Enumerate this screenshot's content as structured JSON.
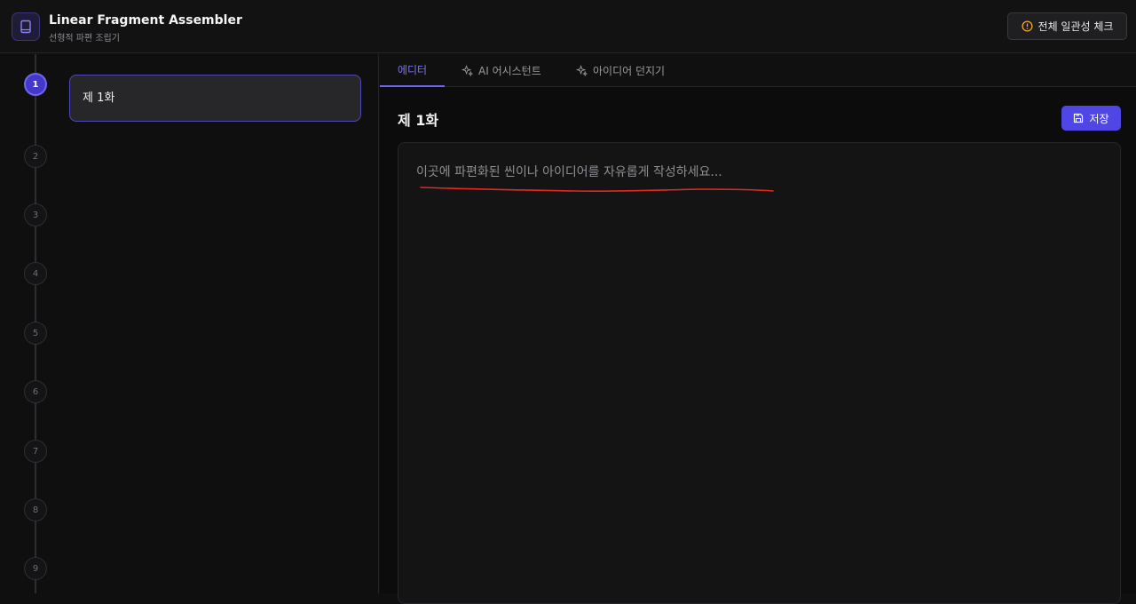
{
  "header": {
    "title": "Linear Fragment Assembler",
    "subtitle": "선형적 파편 조립기",
    "logo_icon": "book-icon",
    "check_button": {
      "label": "전체 일관성 체크",
      "icon": "alert-circle-icon",
      "icon_color": "#f5a623"
    }
  },
  "timeline": {
    "steps": [
      "1",
      "2",
      "3",
      "4",
      "5",
      "6",
      "7",
      "8",
      "9"
    ],
    "active_step": "1"
  },
  "episodes": [
    {
      "label": "제 1화"
    }
  ],
  "tabs": [
    {
      "label": "에디터",
      "active": true
    },
    {
      "label": "AI 어시스턴트",
      "icon": "sparkles-icon"
    },
    {
      "label": "아이디어 던지기",
      "icon": "sparkles-icon"
    }
  ],
  "editor": {
    "title": "제 1화",
    "save_label": "저장",
    "placeholder": "이곳에 파편화된 씬이나 아이디어를 자유롭게 작성하세요..."
  },
  "colors": {
    "accent": "#4f46e5",
    "accent_light": "#7c73f5",
    "annotation": "#e5281f"
  }
}
